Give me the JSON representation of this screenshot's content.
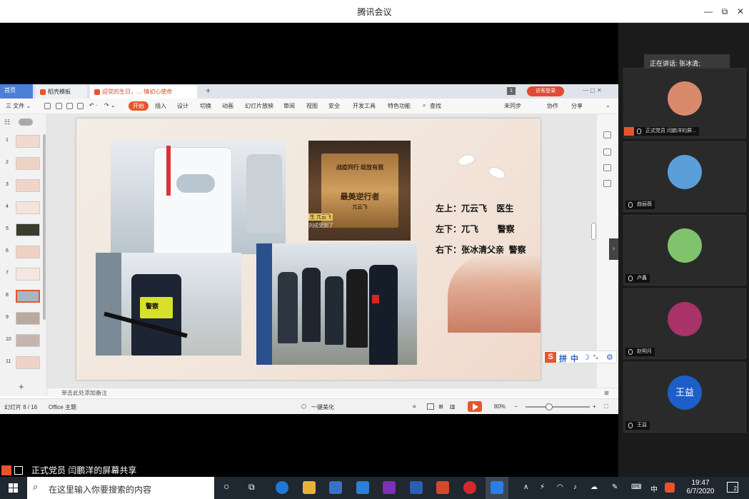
{
  "window": {
    "title": "腾讯会议",
    "controls": [
      "—",
      "⧉",
      "✕"
    ]
  },
  "wps": {
    "tabs": {
      "home": "首页",
      "template": "稻壳模板",
      "document": "迎党的生日，…  情初心使命"
    },
    "visitor_login": "访客登录",
    "tab_count": "1",
    "file_menu": "三 文件 ⌄",
    "menu": [
      "开始",
      "插入",
      "设计",
      "切换",
      "动画",
      "幻灯片放映",
      "审阅",
      "视图",
      "安全",
      "开发工具",
      "特色功能"
    ],
    "search_label": "查找",
    "sync_label": "未同步",
    "collab_label": "协作",
    "share_label": "分享",
    "thumbnails": [
      "1",
      "2",
      "3",
      "4",
      "5",
      "6",
      "7",
      "8",
      "9",
      "10",
      "11"
    ],
    "selected_thumb": "8",
    "add_slide": "+",
    "notes_placeholder": "单击此处添加备注",
    "status": {
      "slide_counter": "幻灯片 8 / 16",
      "theme": "Office 主题",
      "beautify": "一键美化",
      "zoom": "80%",
      "zoom_minus": "−",
      "zoom_plus": "+"
    },
    "slide": {
      "line1": "左上：兀云飞    医生",
      "line2": "左下：兀飞        警察",
      "line3": "右下：张冰清父亲  警察",
      "plaque_line1": "战疫同行 绽放有我",
      "plaque_title": "最美逆行者",
      "plaque_name": "兀云飞",
      "photo2_tag": "生 兀云飞",
      "photo2_sub": "刘成受到了",
      "police_badge": "警察"
    }
  },
  "ime": {
    "logo": "S",
    "items": [
      "拼",
      "中",
      "☽",
      "°₀",
      "⚙"
    ]
  },
  "meeting": {
    "speaking": "正在讲话: 张冰清;",
    "participants": [
      {
        "name": "正式党员 闫鹏洋的屏...",
        "avatar": "",
        "color": "#d88a6a"
      },
      {
        "name": "曲丽薇",
        "avatar": "",
        "color": "#5a9fd8"
      },
      {
        "name": "卢鑫",
        "avatar": "",
        "color": "#7fc46c"
      },
      {
        "name": "赵明月",
        "avatar": "",
        "color": "#a8326a"
      },
      {
        "name": "王益",
        "avatar": "王益",
        "color": "#1e5ec8"
      }
    ],
    "share_caption": "正式党员 闫鹏洋的屏幕共享",
    "collapse": "›"
  },
  "taskbar": {
    "search_placeholder": "在这里输入你要搜索的内容",
    "ime_mode": "中",
    "time": "19:47",
    "date": "6/7/2020",
    "notifications": "2"
  }
}
